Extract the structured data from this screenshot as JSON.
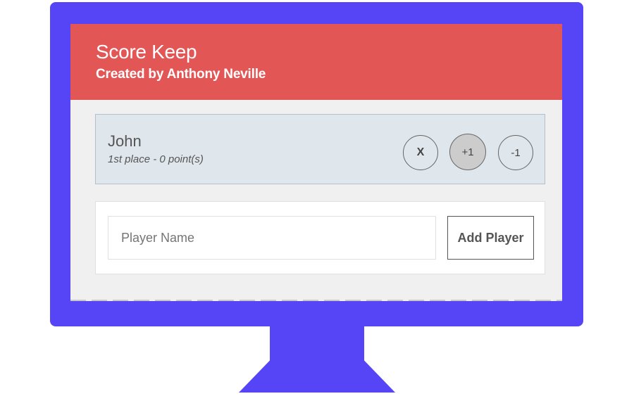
{
  "colors": {
    "monitor": "#5545f7",
    "header": "#e35656",
    "screen_bg": "#f0f0f0",
    "card_bg": "#dfe6ec"
  },
  "app": {
    "title": "Score Keep",
    "subtitle": "Created by Anthony Neville"
  },
  "players": [
    {
      "name": "John",
      "status": "1st place - 0 point(s)",
      "buttons": {
        "remove_label": "X",
        "plus_label": "+1",
        "minus_label": "-1"
      }
    }
  ],
  "add_form": {
    "placeholder": "Player Name",
    "value": "",
    "button_label": "Add Player"
  }
}
